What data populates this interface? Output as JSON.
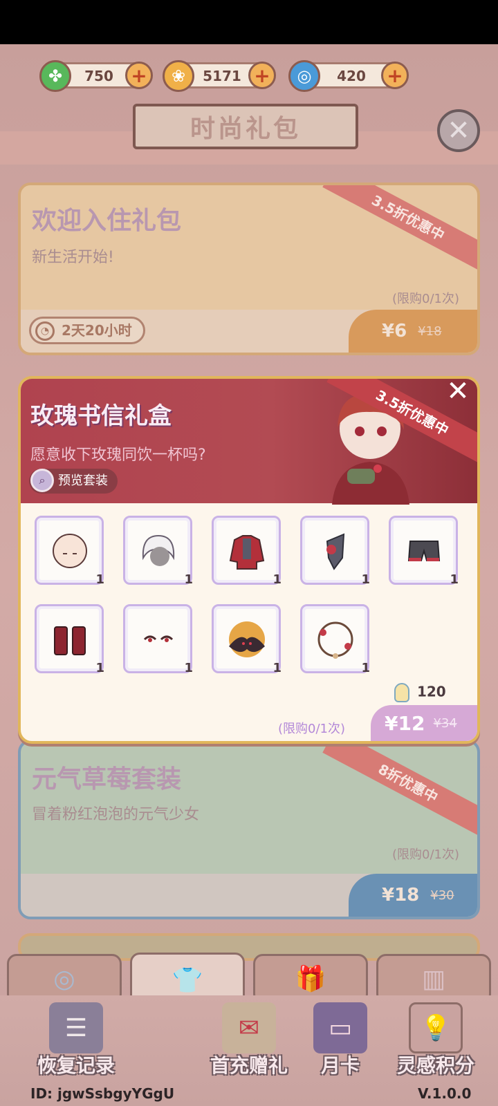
{
  "currencies": [
    {
      "name": "clover",
      "value": "750",
      "color": "#58b85b",
      "icon": "clover-icon"
    },
    {
      "name": "coin",
      "value": "5171",
      "color": "#f0b048",
      "icon": "coin-icon"
    },
    {
      "name": "gem",
      "value": "420",
      "color": "#4a9ad8",
      "icon": "swirl-gem-icon"
    }
  ],
  "header": {
    "title": "时尚礼包"
  },
  "cards": {
    "welcome": {
      "title": "欢迎入住礼包",
      "subtitle": "新生活开始!",
      "ribbon": "3.5折优惠中",
      "limit": "(限购0/1次)",
      "timer": "2天20小时",
      "price": "¥6",
      "old_price": "¥18"
    },
    "strawberry": {
      "title": "元气草莓套装",
      "subtitle": "冒着粉红泡泡的元气少女",
      "ribbon": "8折优惠中",
      "limit": "(限购0/1次)",
      "price": "¥18",
      "old_price": "¥30"
    }
  },
  "popup": {
    "title": "玫瑰书信礼盒",
    "subtitle": "愿意收下玫瑰同饮一杯吗?",
    "preview_label": "预览套装",
    "ribbon": "3.5折优惠中",
    "items": [
      {
        "name": "face-base",
        "count": "1"
      },
      {
        "name": "white-hair",
        "count": "1"
      },
      {
        "name": "red-jacket",
        "count": "1"
      },
      {
        "name": "rose-hat",
        "count": "1"
      },
      {
        "name": "shorts",
        "count": "1"
      },
      {
        "name": "boots",
        "count": "1"
      },
      {
        "name": "eyes",
        "count": "1"
      },
      {
        "name": "bat-backdrop",
        "count": "1"
      },
      {
        "name": "rose-wreath-frame",
        "count": "1"
      }
    ],
    "inspiration_points": "120",
    "limit": "(限购0/1次)",
    "price": "¥12",
    "old_price": "¥34"
  },
  "tabs": [
    {
      "icon": "swirl-icon"
    },
    {
      "icon": "shirt-icon",
      "active": true
    },
    {
      "icon": "gift-icon"
    },
    {
      "icon": "scroll-icon"
    }
  ],
  "nav": [
    {
      "label": "恢复记录",
      "icon": "clipboard-icon"
    },
    {
      "label": "首充赠礼",
      "icon": "envelope-icon"
    },
    {
      "label": "月卡",
      "icon": "card-icon"
    },
    {
      "label": "灵感积分",
      "icon": "bulb-icon"
    }
  ],
  "footer": {
    "id": "ID: jgwSsbgyYGgU",
    "version": "V.1.0.0"
  }
}
